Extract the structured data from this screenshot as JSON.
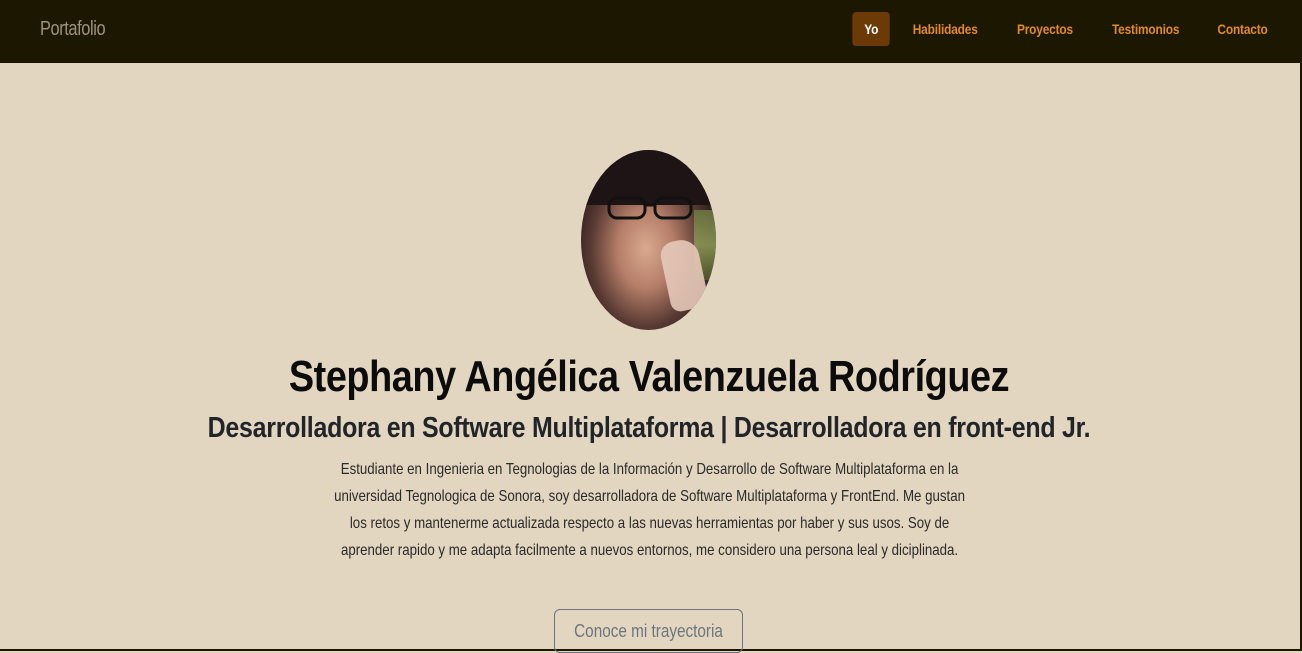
{
  "navbar": {
    "brand": "Portafolio",
    "items": [
      {
        "label": "Yo",
        "active": true
      },
      {
        "label": "Habilidades",
        "active": false
      },
      {
        "label": "Proyectos",
        "active": false
      },
      {
        "label": "Testimonios",
        "active": false
      },
      {
        "label": "Contacto",
        "active": false
      }
    ]
  },
  "hero": {
    "name": "Stephany Angélica Valenzuela Rodríguez",
    "subtitle": "Desarrolladora en Software Multiplataforma | Desarrolladora en front-end Jr.",
    "description": "Estudiante en Ingenieria en Tegnologias de la Información y Desarrollo de Software Multiplataforma en la universidad Tegnologica de Sonora, soy desarrolladora de Software Multiplataforma y FrontEnd. Me gustan los retos y mantenerme actualizada respecto a las nuevas herramientas por haber y sus usos. Soy de aprender rapido y me adapta facilmente a nuevos entornos, me considero una persona leal y diciplinada.",
    "cta_label": "Conoce mi trayectoria"
  },
  "colors": {
    "navbar_bg": "#1c1700",
    "page_bg": "#e3d6c0",
    "nav_link": "#e08a2c",
    "nav_active_bg": "#6b3a07"
  }
}
